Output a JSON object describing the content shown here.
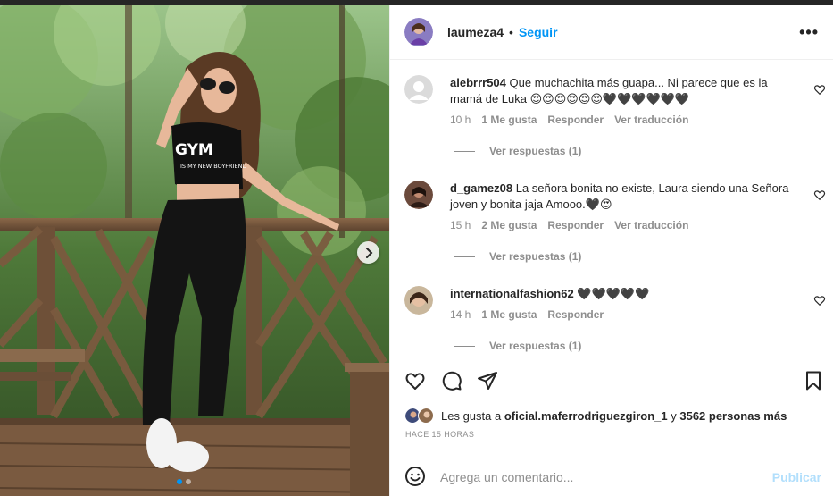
{
  "post": {
    "username": "laumeza4",
    "separator": "•",
    "follow_label": "Seguir",
    "more_label": "•••"
  },
  "comments": [
    {
      "username": "alebrrr504",
      "text": "Que muchachita más guapa... Ni parece que es la mamá de Luka 😍😍😍😍😍😍🖤🖤🖤🖤🖤🖤",
      "time": "10 h",
      "likes": "1 Me gusta",
      "reply": "Responder",
      "translate": "Ver traducción",
      "view_replies": "Ver respuestas (1)"
    },
    {
      "username": "d_gamez08",
      "text": "La señora bonita no existe, Laura siendo una Señora joven y bonita jaja Amooo.🖤😍",
      "time": "15 h",
      "likes": "2 Me gusta",
      "reply": "Responder",
      "translate": "Ver traducción",
      "view_replies": "Ver respuestas (1)"
    },
    {
      "username": "internationalfashion62",
      "text": "🖤🖤🖤🖤🖤",
      "time": "14 h",
      "likes": "1 Me gusta",
      "reply": "Responder",
      "view_replies": "Ver respuestas (1)"
    }
  ],
  "likes_line": {
    "prefix": "Les gusta a",
    "user": "oficial.maferrodriguezgiron_1",
    "middle": "y",
    "count": "3562 personas más"
  },
  "timestamp": "HACE 15 HORAS",
  "composer": {
    "placeholder": "Agrega un comentario...",
    "publish_label": "Publicar"
  },
  "photo": {
    "shirt_text": "GYM",
    "shirt_subtext": "IS MY NEW BOYFRIEND"
  },
  "icons": {
    "like": "heart-icon",
    "comment": "comment-icon",
    "share": "paper-plane-icon",
    "save": "bookmark-icon",
    "emoji": "smiley-icon",
    "next": "chevron-right-icon"
  },
  "colors": {
    "accent": "#0095f6",
    "muted": "#8e8e8e",
    "publish_disabled": "#b2dffc"
  }
}
